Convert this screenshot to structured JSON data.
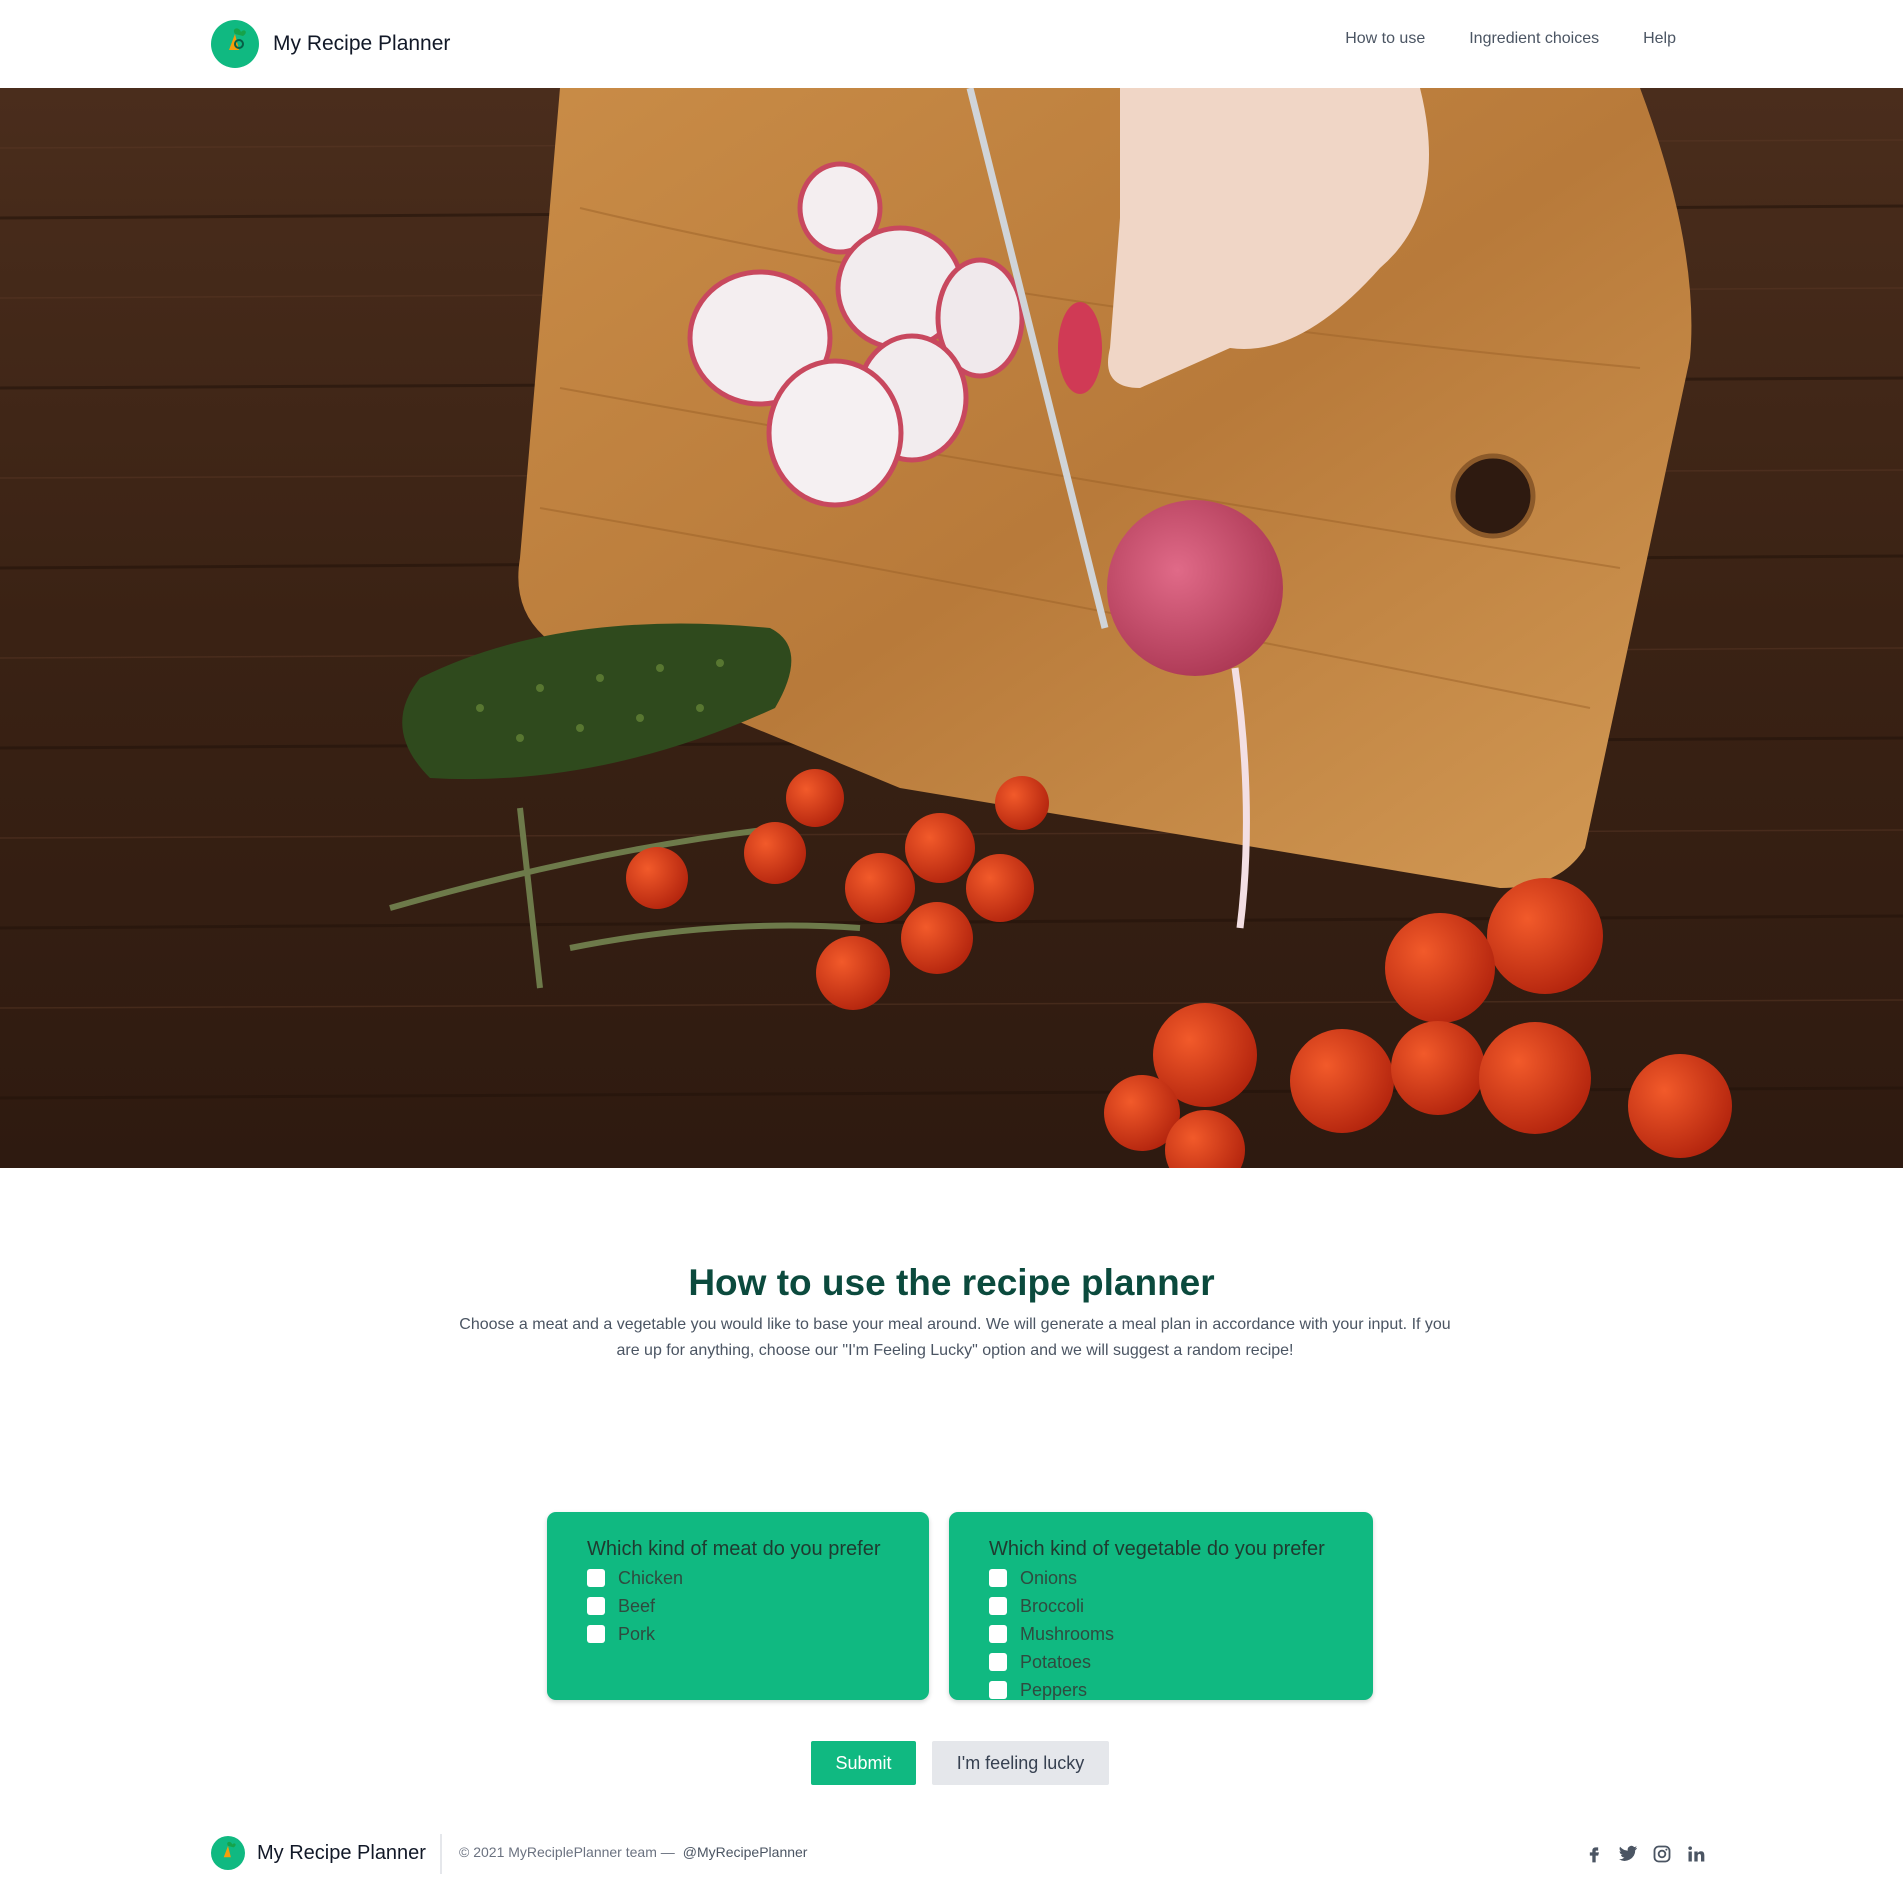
{
  "header": {
    "brand": "My Recipe Planner",
    "logo_icon": "vegetable-leaf-icon",
    "nav": [
      {
        "label": "How to use"
      },
      {
        "label": "Ingredient choices"
      },
      {
        "label": "Help"
      }
    ]
  },
  "hero": {
    "image": "cutting-board-vegetables-photo"
  },
  "intro": {
    "title": "How to use the recipe planner",
    "description": "Choose a meat and a vegetable you would like to base your meal around. We will generate a meal plan in accordance with your input. If you are up for anything, choose our \"I'm Feeling Lucky\" option and we will suggest a random recipe!"
  },
  "meat": {
    "title": "Which kind of meat do you prefer",
    "options": [
      "Chicken",
      "Beef",
      "Pork"
    ]
  },
  "vegetable": {
    "title": "Which kind of vegetable do you prefer",
    "options": [
      "Onions",
      "Broccoli",
      "Mushrooms",
      "Potatoes",
      "Peppers"
    ]
  },
  "buttons": {
    "submit": "Submit",
    "lucky": "I'm feeling lucky"
  },
  "footer": {
    "brand": "My Recipe Planner",
    "copyright": "© 2021 MyReciplePlanner team —",
    "handle": "@MyRecipePlanner",
    "social": [
      "facebook-icon",
      "twitter-icon",
      "instagram-icon",
      "linkedin-icon"
    ]
  },
  "colors": {
    "accent": "#10b981",
    "title": "#0b4a3d",
    "button_secondary": "#e5e7eb"
  }
}
